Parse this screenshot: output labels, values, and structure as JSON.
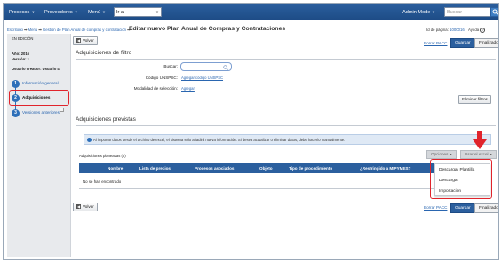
{
  "topnav": {
    "items": [
      "Procesos",
      "Proveedores",
      "Menú"
    ],
    "go_select_value": "Ir a",
    "admin_mode": "Admin Mode",
    "search_placeholder": "Buscar"
  },
  "breadcrumb": {
    "items": [
      "Escritorio",
      "Menú",
      "Gestión de Plan Anual de compras y contratación"
    ],
    "current": "Editar nuevo Plan Anual de Compras y Contrataciones"
  },
  "page_info": {
    "id_label": "Id de página:",
    "id_value": "1000016",
    "help_label": "Ayuda"
  },
  "left_panel": {
    "status": "EN EDICIÓN",
    "year": "Año: 2016",
    "version": "Versión: 1",
    "creator": "Usuario creador: Usuario 4",
    "steps": [
      {
        "num": "1",
        "label": "Información general"
      },
      {
        "num": "2",
        "label": "Adquisiciones"
      },
      {
        "num": "3",
        "label": "Versiones anteriores"
      }
    ]
  },
  "actions": {
    "back_label": "Volver",
    "delete_pacc": "Borrar PACC",
    "save": "Guardar",
    "finalize": "Finalizado"
  },
  "filter": {
    "title": "Adquisiciones de filtro",
    "search_label": "Buscar:",
    "unspsc_label": "Código UNSPSC:",
    "unspsc_link": "Agregar código UNSPSC",
    "modality_label": "Modalidad de selección:",
    "modality_link": "Agregar",
    "clear_filters": "Eliminar filtros"
  },
  "planned": {
    "title": "Adquisiciones previstas",
    "info_text": "Al importar datos desde el archivo de excel, el sistema sólo añadirá nueva información. Si desea actualizar o eliminar datos, debe hacerlo manualmente.",
    "count_label": "Adquisiciones planeadas (0)",
    "options_btn": "Opciones",
    "excel_btn": "Usar el excel",
    "columns": [
      "Nombre",
      "Lista de precios",
      "Procesos asociados",
      "Objeto",
      "Tipo de procedimiento",
      "¿Restringido a MIPYMES?"
    ],
    "empty_text": "No se han encontrado",
    "excel_menu": [
      "Descargar Plantilla",
      "Descarga",
      "Importación"
    ]
  },
  "colors": {
    "nav_blue": "#2b5f9e",
    "highlight_red": "#e0242c",
    "link_blue": "#2a66b0"
  }
}
